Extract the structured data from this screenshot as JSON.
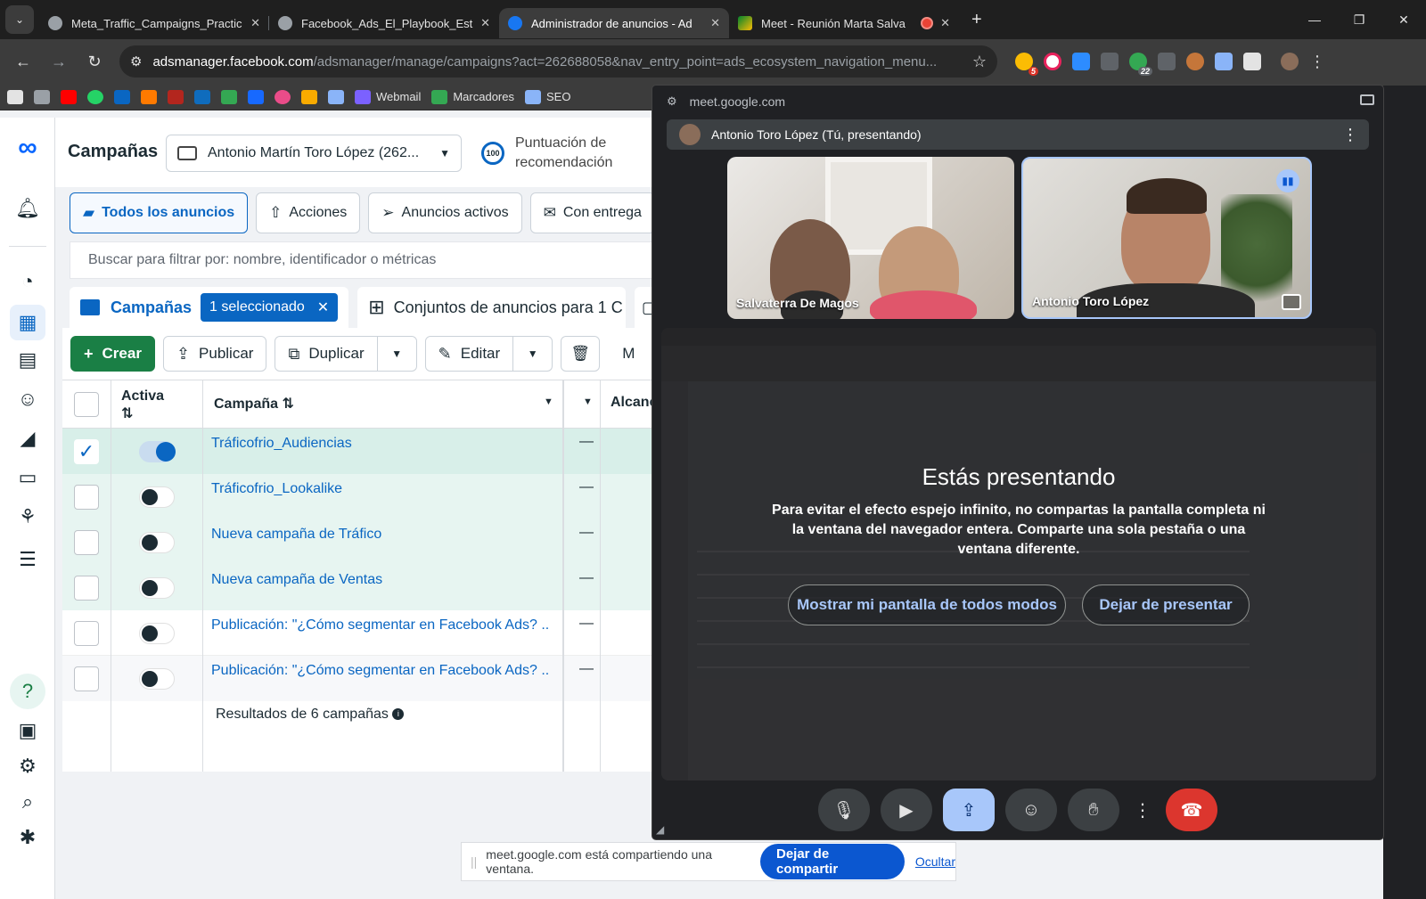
{
  "browser": {
    "tabs": [
      {
        "title": "Meta_Traffic_Campaigns_Practic",
        "active": false
      },
      {
        "title": "Facebook_Ads_El_Playbook_Estr",
        "active": false
      },
      {
        "title": "Administrador de anuncios - Ad",
        "active": true
      },
      {
        "title": "Meet - Reunión Marta Salva",
        "active": false
      }
    ],
    "url_host": "adsmanager.facebook.com",
    "url_path": "/adsmanager/manage/campaigns?act=262688058&nav_entry_point=ads_ecosystem_navigation_menu...",
    "bookmarks": {
      "webmail": "Webmail",
      "marcadores": "Marcadores",
      "seo": "SEO"
    },
    "ext_badges": {
      "b1": "5",
      "b2": "22"
    }
  },
  "ads_manager": {
    "page_title": "Campañas",
    "account": "Antonio Martín Toro López (262...",
    "score_value": "100",
    "score_label": "Puntuación de recomendación",
    "filters": [
      "Todos los anuncios",
      "Acciones",
      "Anuncios activos",
      "Con entrega"
    ],
    "search_placeholder": "Buscar para filtrar por: nombre, identificador o métricas",
    "levels": {
      "campaigns": "Campañas",
      "selected_badge": "1 seleccionado",
      "adsets": "Conjuntos de anuncios para 1 C"
    },
    "actions": {
      "create": "Crear",
      "publish": "Publicar",
      "duplicate": "Duplicar",
      "edit": "Editar",
      "more": "M"
    },
    "table": {
      "headers": {
        "active": "Activa",
        "campaign": "Campaña",
        "reach": "Alcance"
      },
      "rows": [
        {
          "name": "Tráficofrio_Audiencias",
          "on": true,
          "checked": true,
          "value": "—"
        },
        {
          "name": "Tráficofrio_Lookalike",
          "on": false,
          "checked": false,
          "value": "—"
        },
        {
          "name": "Nueva campaña de Tráfico",
          "on": false,
          "checked": false,
          "value": "—"
        },
        {
          "name": "Nueva campaña de Ventas",
          "on": false,
          "checked": false,
          "value": "—"
        },
        {
          "name": "Publicación: \"¿Cómo segmentar en Facebook Ads? ...",
          "on": false,
          "checked": false,
          "value": "—"
        },
        {
          "name": "Publicación: \"¿Cómo segmentar en Facebook Ads? ...",
          "on": false,
          "checked": false,
          "value": "—"
        }
      ],
      "results": "Resultados de 6 campañas"
    }
  },
  "share_bar": {
    "text": "meet.google.com está compartiendo una ventana.",
    "stop": "Dejar de compartir",
    "hide": "Ocultar"
  },
  "meet": {
    "host": "meet.google.com",
    "presenter_bar": "Antonio Toro López (Tú, presentando)",
    "tiles": [
      {
        "name": "Salvaterra De Magos"
      },
      {
        "name": "Antonio Toro López"
      }
    ],
    "overlay": {
      "heading": "Estás presentando",
      "body": "Para evitar el efecto espejo infinito, no compartas la pantalla completa ni la ventana del navegador entera. Comparte una sola pestaña o una ventana diferente.",
      "show_anyway": "Mostrar mi pantalla de todos modos",
      "stop_presenting": "Dejar de presentar"
    }
  },
  "colors": {
    "brand_blue": "#0a66c2",
    "create_green": "#1a7f45",
    "meet_dark": "#202124",
    "meet_accent": "#a8c7fa",
    "end_call_red": "#dc362e"
  }
}
